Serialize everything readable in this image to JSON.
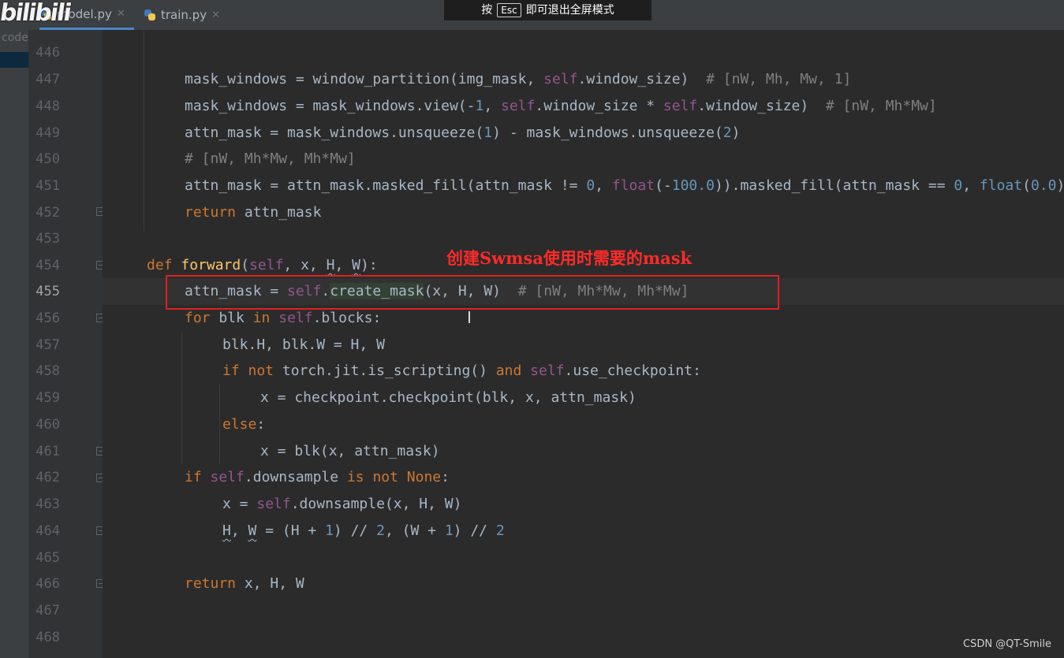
{
  "sidebar": {
    "folder_label": "code"
  },
  "logo": {
    "text": "bilibili"
  },
  "tabs": [
    {
      "label": "model.py",
      "active": true
    },
    {
      "label": "train.py",
      "active": false
    }
  ],
  "tab_close_glyph": "✕",
  "fullscreen_tip": {
    "prefix": "按",
    "key": "Esc",
    "suffix": "即可退出全屏模式"
  },
  "editor": {
    "current_line": 455,
    "line_numbers": [
      446,
      447,
      448,
      449,
      450,
      451,
      452,
      453,
      454,
      455,
      456,
      457,
      458,
      459,
      460,
      461,
      462,
      463,
      464,
      465,
      466,
      467,
      468
    ]
  },
  "annotation": {
    "text": "创建Swmsa使用时需要的mask"
  },
  "watermark": "CSDN @QT-Smile",
  "colors": {
    "keyword": "#cc7832",
    "self": "#94558d",
    "number": "#6897bb",
    "function": "#ffc66d",
    "comment": "#808080",
    "annotation": "#ff2a2a"
  },
  "icons": {
    "gutter_hint": "lightbulb-icon",
    "fold_marker": "fold-icon",
    "text_cursor": "i-beam-icon"
  }
}
